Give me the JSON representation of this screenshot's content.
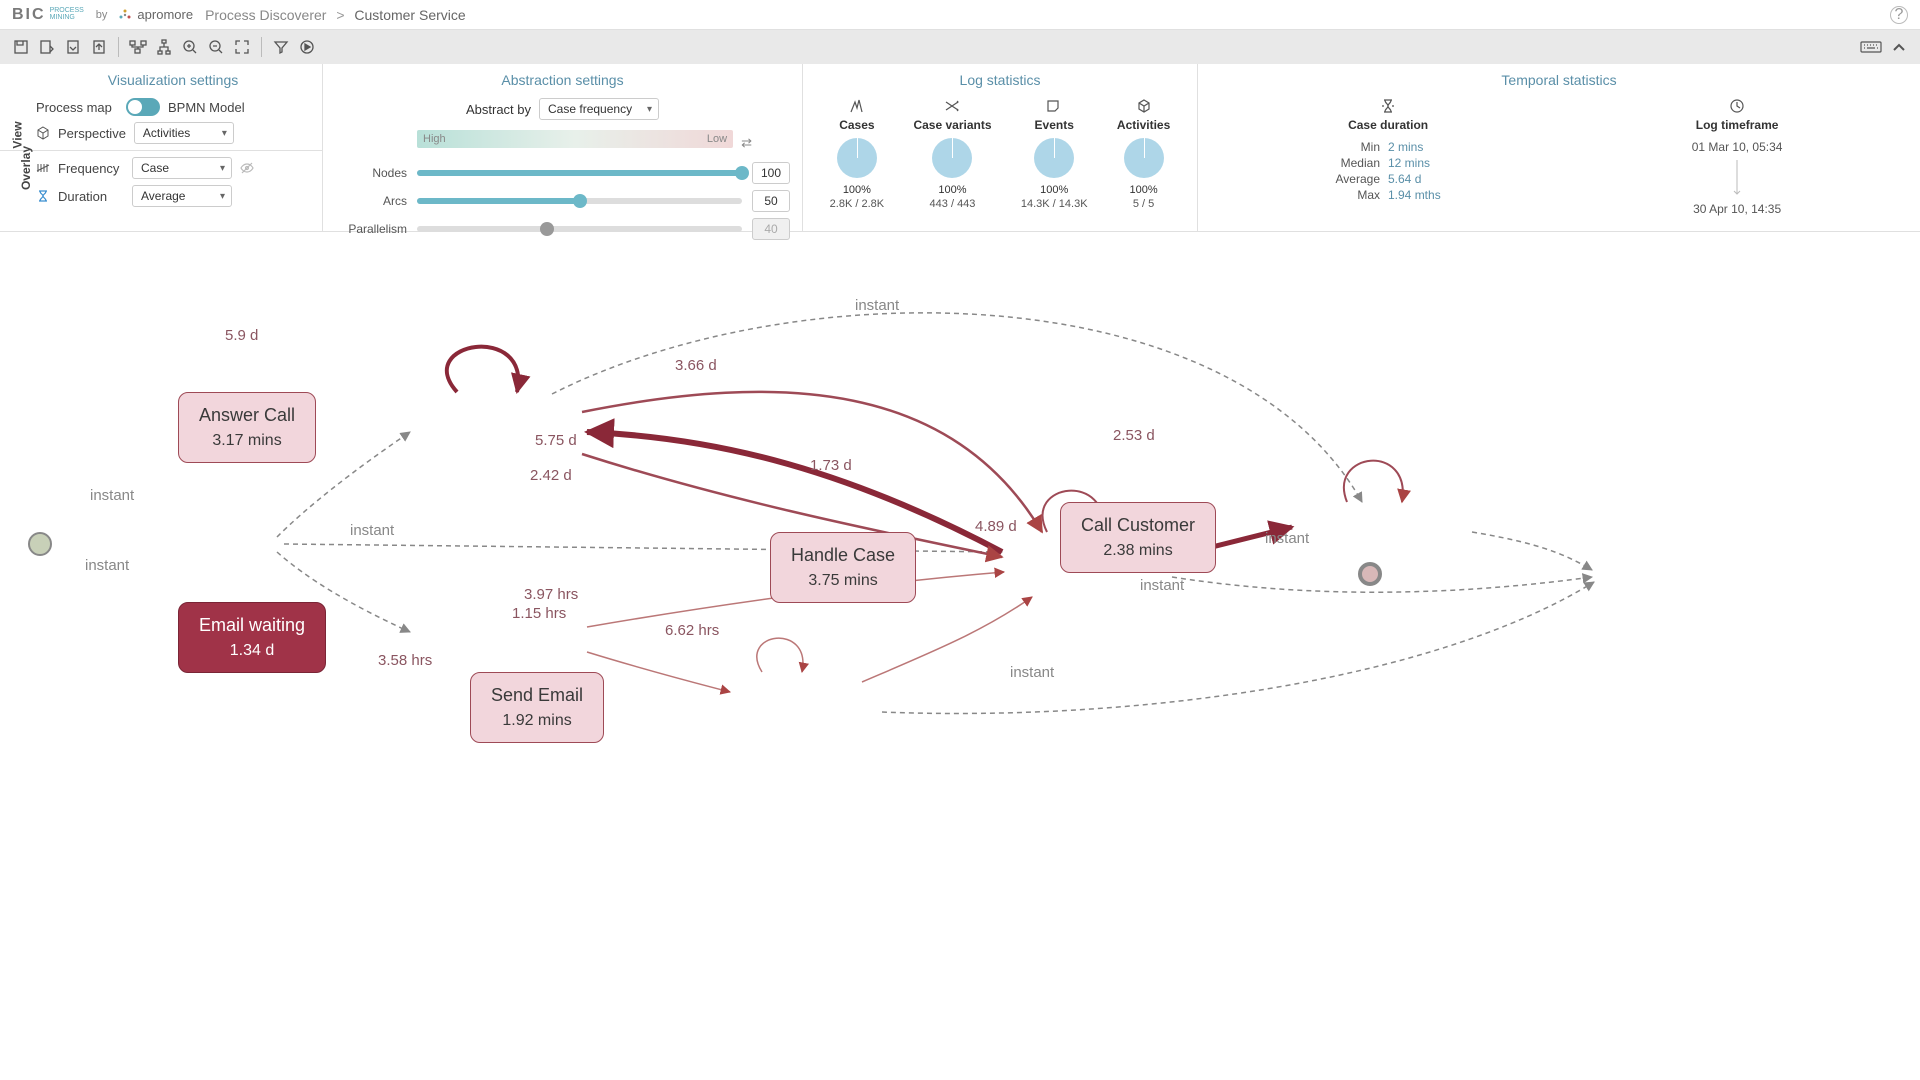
{
  "header": {
    "logo_bic": "BIC",
    "logo_sub1": "PROCESS",
    "logo_sub2": "MINING",
    "logo_by": "by",
    "logo_apromore": "apromore",
    "app_name": "Process Discoverer",
    "breadcrumb_sep": ">",
    "breadcrumb_current": "Customer Service"
  },
  "vis": {
    "title": "Visualization settings",
    "tab_view": "View",
    "tab_overlay": "Overlay",
    "process_map": "Process map",
    "bpmn_model": "BPMN Model",
    "perspective": "Perspective",
    "perspective_val": "Activities",
    "frequency": "Frequency",
    "frequency_val": "Case",
    "duration": "Duration",
    "duration_val": "Average"
  },
  "abs": {
    "title": "Abstraction settings",
    "abstract_by": "Abstract by",
    "abstract_by_val": "Case frequency",
    "high": "High",
    "low": "Low",
    "nodes": "Nodes",
    "nodes_val": "100",
    "arcs": "Arcs",
    "arcs_val": "50",
    "parallel": "Parallelism",
    "parallel_val": "40"
  },
  "log": {
    "title": "Log statistics",
    "cases": {
      "name": "Cases",
      "pct": "100%",
      "cnt": "2.8K / 2.8K"
    },
    "variants": {
      "name": "Case variants",
      "pct": "100%",
      "cnt": "443 / 443"
    },
    "events": {
      "name": "Events",
      "pct": "100%",
      "cnt": "14.3K / 14.3K"
    },
    "activities": {
      "name": "Activities",
      "pct": "100%",
      "cnt": "5 / 5"
    }
  },
  "temp": {
    "title": "Temporal statistics",
    "cd_name": "Case duration",
    "tf_name": "Log timeframe",
    "rows": {
      "min_k": "Min",
      "min_v": "2 mins",
      "med_k": "Median",
      "med_v": "12 mins",
      "avg_k": "Average",
      "avg_v": "5.64 d",
      "max_k": "Max",
      "max_v": "1.94 mths"
    },
    "tf_start": "01 Mar 10, 05:34",
    "tf_end": "30 Apr 10, 14:35"
  },
  "graph": {
    "nodes": {
      "answer": {
        "title": "Answer Call",
        "sub": "3.17 mins"
      },
      "email": {
        "title": "Email waiting",
        "sub": "1.34 d"
      },
      "send": {
        "title": "Send Email",
        "sub": "1.92 mins"
      },
      "handle": {
        "title": "Handle Case",
        "sub": "3.75 mins"
      },
      "call": {
        "title": "Call Customer",
        "sub": "2.38 mins"
      }
    },
    "edges": {
      "answer_self": "5.9 d",
      "handle_self": "1.73 d",
      "call_self": "2.53 d",
      "send_self": "1.15 hrs",
      "start_answer": "instant",
      "start_email": "instant",
      "answer_call_top": "instant",
      "answer_handle_top": "3.66 d",
      "answer_handle_mid": "5.75 d",
      "handle_answer": "2.42 d",
      "start_handle": "instant",
      "handle_call": "4.89 d",
      "call_end": "instant",
      "handle_end": "instant",
      "email_handle": "3.97 hrs",
      "email_send": "3.58 hrs",
      "send_handle": "6.62 hrs",
      "send_end": "instant"
    }
  }
}
